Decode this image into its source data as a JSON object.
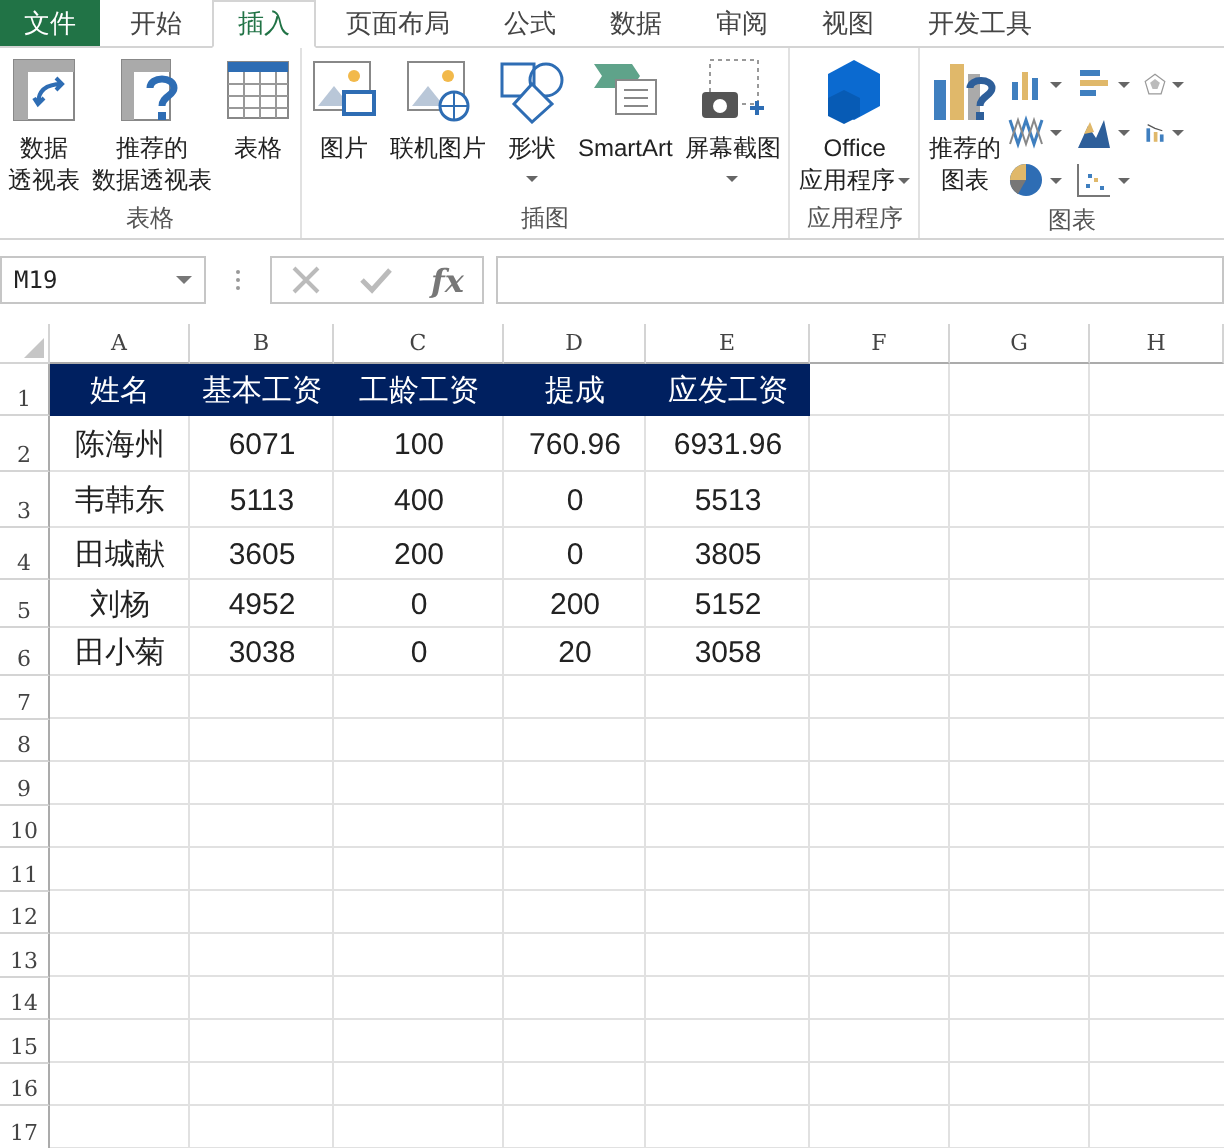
{
  "tabs": [
    {
      "label": "文件",
      "kind": "file",
      "selected": false
    },
    {
      "label": "开始",
      "kind": "tab",
      "selected": false
    },
    {
      "label": "插入",
      "kind": "tab",
      "selected": true
    },
    {
      "label": "页面布局",
      "kind": "tab",
      "selected": false
    },
    {
      "label": "公式",
      "kind": "tab",
      "selected": false
    },
    {
      "label": "数据",
      "kind": "tab",
      "selected": false
    },
    {
      "label": "审阅",
      "kind": "tab",
      "selected": false
    },
    {
      "label": "视图",
      "kind": "tab",
      "selected": false
    },
    {
      "label": "开发工具",
      "kind": "tab",
      "selected": false
    }
  ],
  "ribbon": {
    "groups": [
      {
        "label": "表格",
        "buttons": [
          {
            "kind": "pivot",
            "lines": [
              "数据",
              "透视表"
            ],
            "dropdown": false
          },
          {
            "kind": "recommended_pivot",
            "lines": [
              "推荐的",
              "数据透视表"
            ],
            "dropdown": false
          },
          {
            "kind": "table",
            "lines": [
              "表格"
            ],
            "dropdown": false
          }
        ]
      },
      {
        "label": "插图",
        "buttons": [
          {
            "kind": "picture",
            "lines": [
              "图片"
            ],
            "dropdown": false
          },
          {
            "kind": "online_picture",
            "lines": [
              "联机图片"
            ],
            "dropdown": false
          },
          {
            "kind": "shapes",
            "lines": [
              "形状"
            ],
            "dropdown": true
          },
          {
            "kind": "smartart",
            "lines": [
              "SmartArt"
            ],
            "dropdown": false
          },
          {
            "kind": "screenshot",
            "lines": [
              "屏幕截图"
            ],
            "dropdown": true
          }
        ]
      },
      {
        "label": "应用程序",
        "buttons": [
          {
            "kind": "office_apps",
            "lines": [
              "Office",
              "应用程序"
            ],
            "dropdown": true
          }
        ]
      },
      {
        "label": "图表",
        "buttons": [
          {
            "kind": "recommended_charts",
            "lines": [
              "推荐的",
              "图表"
            ],
            "dropdown": false
          },
          {
            "kind": "chart_gallery"
          }
        ]
      }
    ]
  },
  "formula_bar": {
    "name_box": "M19",
    "function_button": "fx"
  },
  "sheet": {
    "columns": [
      "A",
      "B",
      "C",
      "D",
      "E",
      "F",
      "G",
      "H"
    ],
    "rows": [
      {
        "number": "1",
        "kind": "header",
        "cells": [
          "姓名",
          "基本工资",
          "工龄工资",
          "提成",
          "应发工资"
        ]
      },
      {
        "number": "2",
        "kind": "data",
        "cells": [
          "陈海州",
          "6071",
          "100",
          "760.96",
          "6931.96"
        ]
      },
      {
        "number": "3",
        "kind": "data",
        "cells": [
          "韦韩东",
          "5113",
          "400",
          "0",
          "5513"
        ]
      },
      {
        "number": "4",
        "kind": "data",
        "cells": [
          "田城献",
          "3605",
          "200",
          "0",
          "3805"
        ]
      },
      {
        "number": "5",
        "kind": "data",
        "cells": [
          "刘杨",
          "4952",
          "0",
          "200",
          "5152"
        ]
      },
      {
        "number": "6",
        "kind": "data",
        "cells": [
          "田小菊",
          "3038",
          "0",
          "20",
          "3058"
        ]
      },
      {
        "number": "7"
      },
      {
        "number": "8"
      },
      {
        "number": "9"
      },
      {
        "number": "10"
      },
      {
        "number": "11"
      },
      {
        "number": "12"
      },
      {
        "number": "13"
      },
      {
        "number": "14"
      },
      {
        "number": "15"
      },
      {
        "number": "16"
      },
      {
        "number": "17"
      }
    ]
  }
}
